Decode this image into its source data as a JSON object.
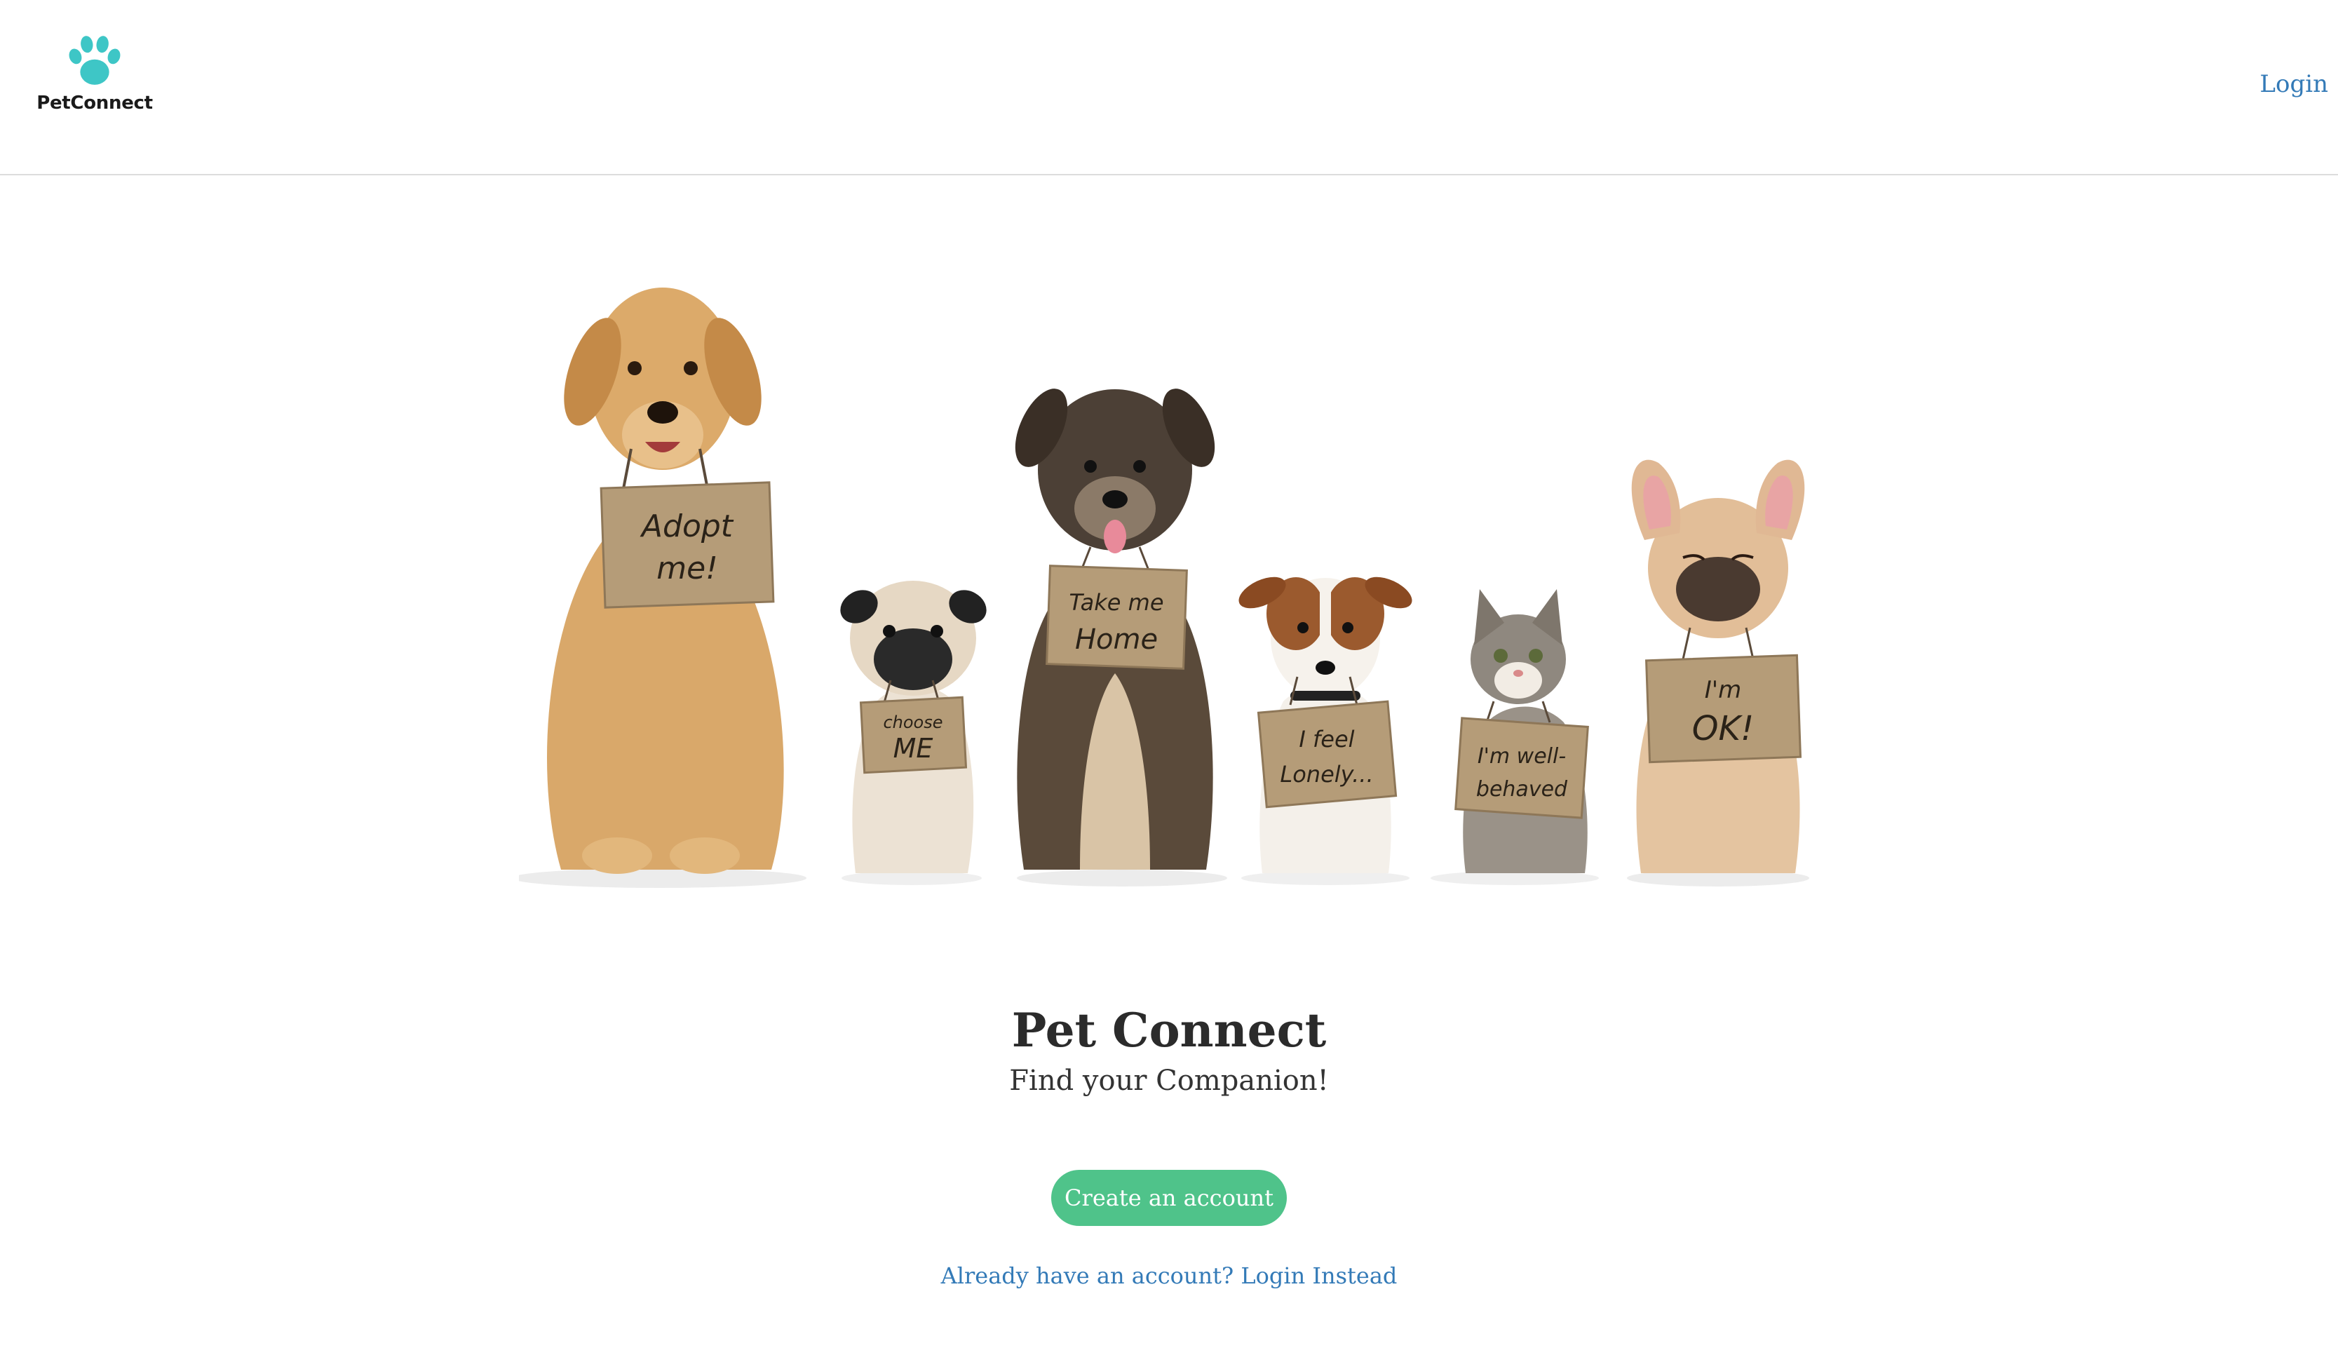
{
  "header": {
    "brand_name": "PetConnect",
    "login_link": "Login"
  },
  "hero": {
    "signs": [
      {
        "line1": "Adopt",
        "line2": "me!"
      },
      {
        "line1": "choose",
        "line2": "ME"
      },
      {
        "line1": "Take me",
        "line2": "Home"
      },
      {
        "line1": "I feel",
        "line2": "Lonely..."
      },
      {
        "line1": "I'm well-",
        "line2": "behaved"
      },
      {
        "line1": "I'm",
        "line2": "OK!"
      }
    ]
  },
  "main": {
    "title": "Pet Connect",
    "subtitle": "Find your Companion!",
    "create_account_label": "Create an account",
    "login_instead_label": "Already have an account? Login Instead"
  },
  "colors": {
    "brand_teal": "#3ec6c6",
    "link_blue": "#337ab7",
    "cta_green": "#4fc38a"
  },
  "icons": {
    "logo": "paw-icon"
  }
}
